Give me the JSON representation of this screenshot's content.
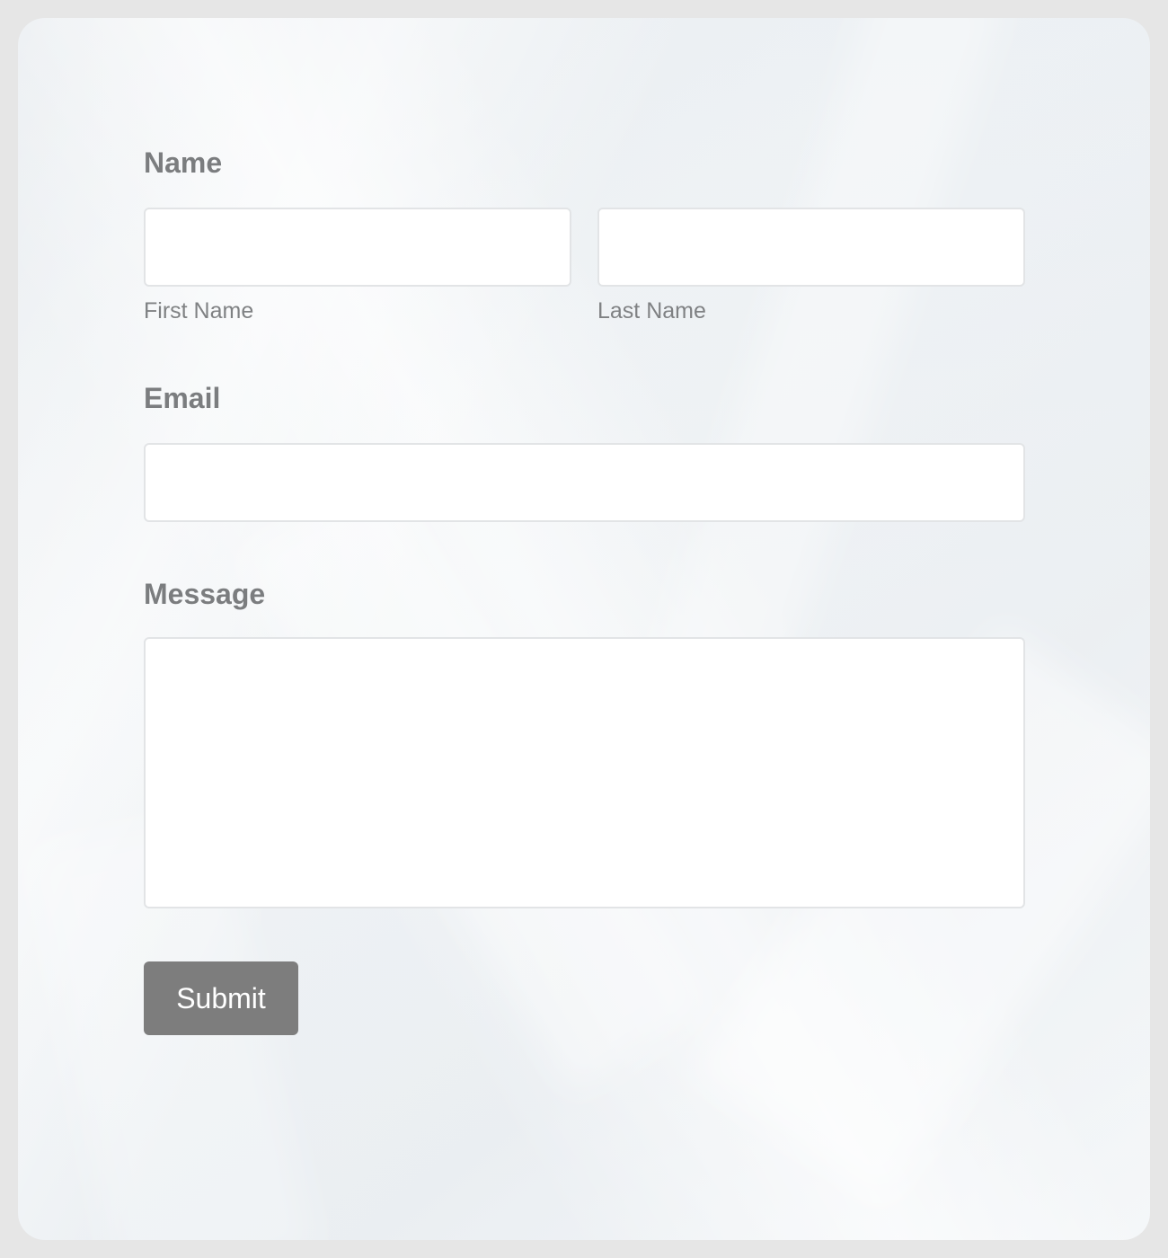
{
  "form": {
    "name_label": "Name",
    "first_name_sublabel": "First Name",
    "last_name_sublabel": "Last Name",
    "first_name_value": "",
    "last_name_value": "",
    "email_label": "Email",
    "email_value": "",
    "message_label": "Message",
    "message_value": "",
    "submit_label": "Submit"
  },
  "colors": {
    "label_text": "#7b7d7f",
    "button_bg": "#7d7d7d",
    "button_text": "#ffffff",
    "input_bg": "#ffffff",
    "frame": "#e6e6e6"
  }
}
